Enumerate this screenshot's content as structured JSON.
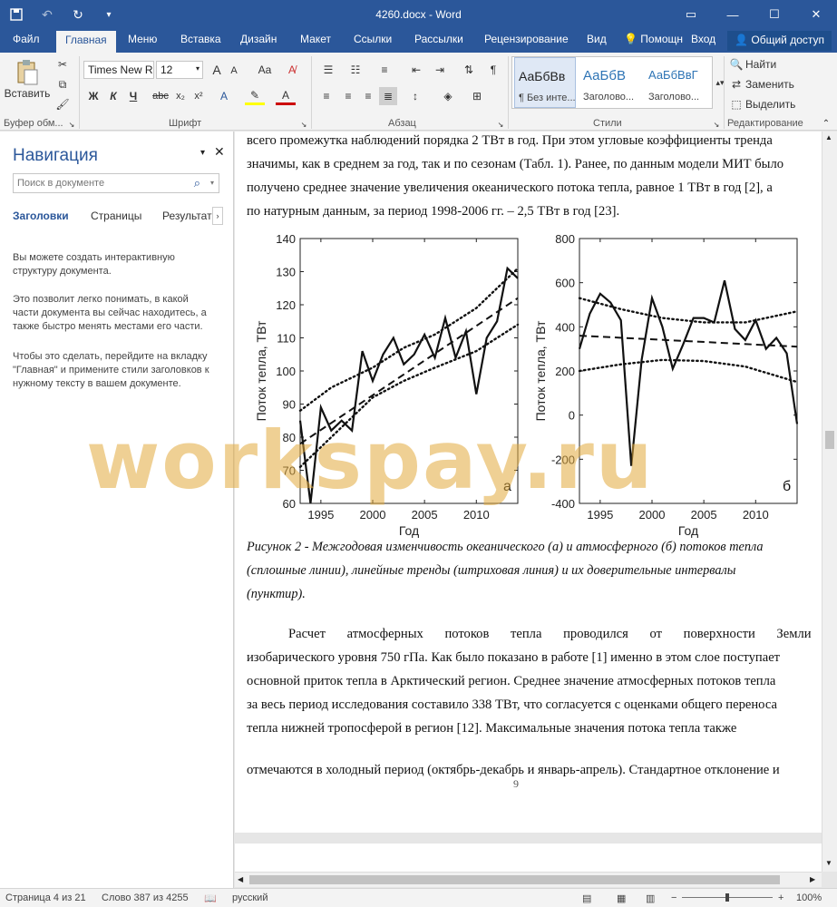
{
  "window": {
    "title": "4260.docx - Word"
  },
  "tabs": {
    "file": "Файл",
    "home": "Главная",
    "menu": "Меню",
    "insert": "Вставка",
    "design": "Дизайн",
    "layout": "Макет",
    "references": "Ссылки",
    "mailings": "Рассылки",
    "review": "Рецензирование",
    "view": "Вид",
    "help": "Помощн",
    "signin": "Вход",
    "share": "Общий доступ"
  },
  "ribbon": {
    "clipboard": {
      "label": "Буфер обм...",
      "paste": "Вставить"
    },
    "font": {
      "label": "Шрифт",
      "name": "Times New R",
      "size": "12",
      "bold": "Ж",
      "italic": "К",
      "underline": "Ч",
      "strike": "abc",
      "sub": "x₂",
      "sup": "x²",
      "grow": "A",
      "shrink": "A",
      "case": "Aa"
    },
    "paragraph": {
      "label": "Абзац"
    },
    "styles": {
      "label": "Стили",
      "items": [
        {
          "sample": "АаБбВв",
          "name": "¶ Без инте..."
        },
        {
          "sample": "АаБбВ",
          "name": "Заголово..."
        },
        {
          "sample": "АаБбВвГ",
          "name": "Заголово..."
        }
      ]
    },
    "editing": {
      "label": "Редактирование",
      "find": "Найти",
      "replace": "Заменить",
      "select": "Выделить"
    }
  },
  "nav": {
    "title": "Навигация",
    "search_placeholder": "Поиск в документе",
    "tabs": [
      "Заголовки",
      "Страницы",
      "Результаты"
    ],
    "text1": "Вы можете создать интерактивную структуру документа.",
    "text2": "Это позволит легко понимать, в какой части документа вы сейчас находитесь, а также быстро менять местами его части.",
    "text3": "Чтобы это сделать, перейдите на вкладку \"Главная\" и примените стили заголовков к нужному тексту в вашем документе."
  },
  "document": {
    "lines_top": [
      "всего промежутка наблюдений порядка 2 ТВт в год. При этом угловые коэффициенты тренда",
      "значимы, как в среднем за год, так и по сезонам (Табл. 1). Ранее, по данным модели МИТ было",
      "получено среднее значение увеличения океанического потока тепла, равное 1 ТВт в год [2], а",
      " по натурным данным, за период 1998-2006 гг. – 2,5 ТВт в год [23]."
    ],
    "caption": [
      "Рисунок 2 - Межгодовая изменчивость океанического (а) и атмосферного (б) потоков тепла",
      "(сплошные линии), линейные тренды (штриховая линия) и их доверительные интервалы",
      "(пунктир)."
    ],
    "lines_bottom": [
      "Расчет атмосферных потоков тепла проводился от поверхности Земли до",
      "изобарического уровня 750 гПа. Как было показано в работе [1] именно в этом слое поступает",
      "основной приток тепла в Арктический регион. Среднее значение атмосферных потоков тепла",
      "за весь период исследования составило 338 ТВт, что согласуется с оценками общего переноса",
      "тепла нижней тропосферой в регион [12]. Максимальные значения потока тепла также"
    ],
    "line_after": "отмечаются в холодный период (октябрь-декабрь и январь-апрель). Стандартное отклонение и",
    "page_number": "9",
    "watermark": "workspay.ru"
  },
  "chart_data": [
    {
      "type": "line",
      "panel_label": "а",
      "xlabel": "Год",
      "ylabel": "Поток тепла, ТВт",
      "xlim": [
        1993,
        2014
      ],
      "ylim": [
        60,
        140
      ],
      "xticks": [
        1995,
        2000,
        2005,
        2010
      ],
      "yticks": [
        60,
        70,
        80,
        90,
        100,
        110,
        120,
        130,
        140
      ],
      "series": [
        {
          "style": "solid",
          "x": [
            1993,
            1994,
            1995,
            1996,
            1997,
            1998,
            1999,
            2000,
            2001,
            2002,
            2003,
            2004,
            2005,
            2006,
            2007,
            2008,
            2009,
            2010,
            2011,
            2012,
            2013,
            2014
          ],
          "y": [
            85,
            60,
            89,
            82,
            85,
            82,
            106,
            97,
            105,
            110,
            102,
            105,
            111,
            104,
            116,
            104,
            112,
            93,
            110,
            115,
            131,
            128
          ]
        },
        {
          "style": "dashed",
          "x": [
            1993,
            2014
          ],
          "y": [
            78,
            122
          ]
        },
        {
          "style": "dotted",
          "x": [
            1993,
            1996,
            2000,
            2003,
            2006,
            2010,
            2014
          ],
          "y": [
            88,
            95,
            101,
            107,
            111,
            119,
            131
          ]
        },
        {
          "style": "dotted",
          "x": [
            1993,
            1996,
            2000,
            2003,
            2006,
            2010,
            2014
          ],
          "y": [
            71,
            80,
            92,
            97,
            101,
            106,
            114
          ]
        }
      ]
    },
    {
      "type": "line",
      "panel_label": "б",
      "xlabel": "Год",
      "ylabel": "Поток тепла, ТВт",
      "xlim": [
        1993,
        2014
      ],
      "ylim": [
        -400,
        800
      ],
      "xticks": [
        1995,
        2000,
        2005,
        2010
      ],
      "yticks": [
        -400,
        -200,
        0,
        200,
        400,
        600,
        800
      ],
      "series": [
        {
          "style": "solid",
          "x": [
            1993,
            1994,
            1995,
            1996,
            1997,
            1998,
            1999,
            2000,
            2001,
            2002,
            2003,
            2004,
            2005,
            2006,
            2007,
            2008,
            2009,
            2010,
            2011,
            2012,
            2013,
            2014
          ],
          "y": [
            300,
            460,
            550,
            510,
            430,
            -230,
            250,
            530,
            400,
            210,
            320,
            440,
            440,
            420,
            610,
            390,
            340,
            430,
            300,
            350,
            280,
            -40
          ]
        },
        {
          "style": "dashed",
          "x": [
            1993,
            2014
          ],
          "y": [
            360,
            310
          ]
        },
        {
          "style": "dotted",
          "x": [
            1993,
            1997,
            2001,
            2005,
            2009,
            2014
          ],
          "y": [
            530,
            480,
            440,
            420,
            420,
            470
          ]
        },
        {
          "style": "dotted",
          "x": [
            1993,
            1997,
            2001,
            2005,
            2009,
            2014
          ],
          "y": [
            200,
            230,
            250,
            245,
            220,
            150
          ]
        }
      ]
    }
  ],
  "status": {
    "page": "Страница 4 из 21",
    "words": "Слово 387 из 4255",
    "lang": "русский",
    "zoom": "100%"
  }
}
